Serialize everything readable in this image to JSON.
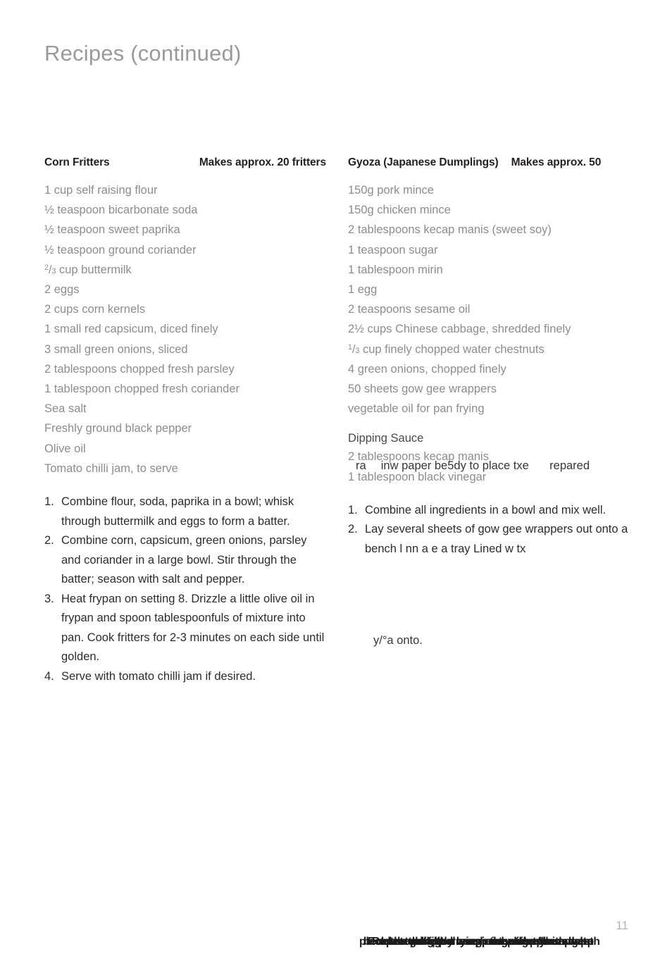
{
  "page": {
    "title": "Recipes (continued)",
    "number": "11"
  },
  "recipes": [
    {
      "name": "Corn Fritters",
      "yield": "Makes approx. 20 fritters",
      "ingredients": [
        "1 cup self raising flour",
        "½ teaspoon bicarbonate soda",
        "½ teaspoon sweet paprika",
        "½ teaspoon ground coriander",
        "FRAC:2/3: cup buttermilk",
        "2 eggs",
        "2 cups corn kernels",
        "1 small red capsicum, diced finely",
        "3 small green onions, sliced",
        "2 tablespoons chopped fresh parsley",
        "1 tablespoon chopped fresh coriander",
        "Sea salt",
        "Freshly ground black pepper",
        "Olive oil",
        "Tomato chilli jam, to serve"
      ],
      "steps": [
        {
          "num": "1.",
          "text": "Combine flour, soda, paprika in a bowl; whisk through buttermilk and eggs to form a batter."
        },
        {
          "num": "2.",
          "text": "Combine corn, capsicum, green onions, parsley and coriander in a large bowl. Stir through the batter; season with salt and pepper."
        },
        {
          "num": "3.",
          "text": "Heat frypan on setting 8. Drizzle a little olive oil in frypan and spoon tablespoonfuls of mixture into pan. Cook fritters for 2-3 minutes on each side until golden."
        },
        {
          "num": "4.",
          "text": "Serve with tomato chilli jam if desired."
        }
      ]
    },
    {
      "name": "Gyoza (Japanese Dumplings)",
      "yield": "Makes approx. 50",
      "ingredients": [
        "150g pork mince",
        "150g chicken mince",
        "2 tablespoons kecap manis (sweet soy)",
        "1 teaspoon sugar",
        "1 tablespoon mirin",
        "1 egg",
        "2 teaspoons sesame oil",
        "2½ cups Chinese cabbage, shredded finely",
        "FRAC:1/3: cup finely chopped water chestnuts",
        "4 green onions, chopped finely",
        "50 sheets gow gee wrappers",
        "vegetable oil for pan frying"
      ],
      "subsection": {
        "heading": "Dipping Sauce",
        "ingredients": [
          "2 tablespoons kecap manis",
          "1 tablespoon black vinegar"
        ]
      },
      "steps": [
        {
          "num": "1.",
          "text": "Combine all ingredients in a bowl and mix well."
        },
        {
          "num": "2.",
          "text": "Lay several sheets of gow gee wrappers out onto a bench l   nn    a   e a tray Lined w   tx"
        }
      ]
    }
  ],
  "artifacts": {
    "overlay_dipping": "ra   inw paper be5dy to place txe    repared",
    "stray_fragment": "y/°a onto.",
    "bottom_overlap": [
      "place the gow gee wrapper onto a floured",
      "bench and lightly brush the edges with wate",
      "Fold the wrapper over and press the edges",
      "Repeat with the remaining wrappers",
      "cover the filled wrappers with a damp cloth",
      "to stop them drying out whilst you wrapp"
    ]
  }
}
